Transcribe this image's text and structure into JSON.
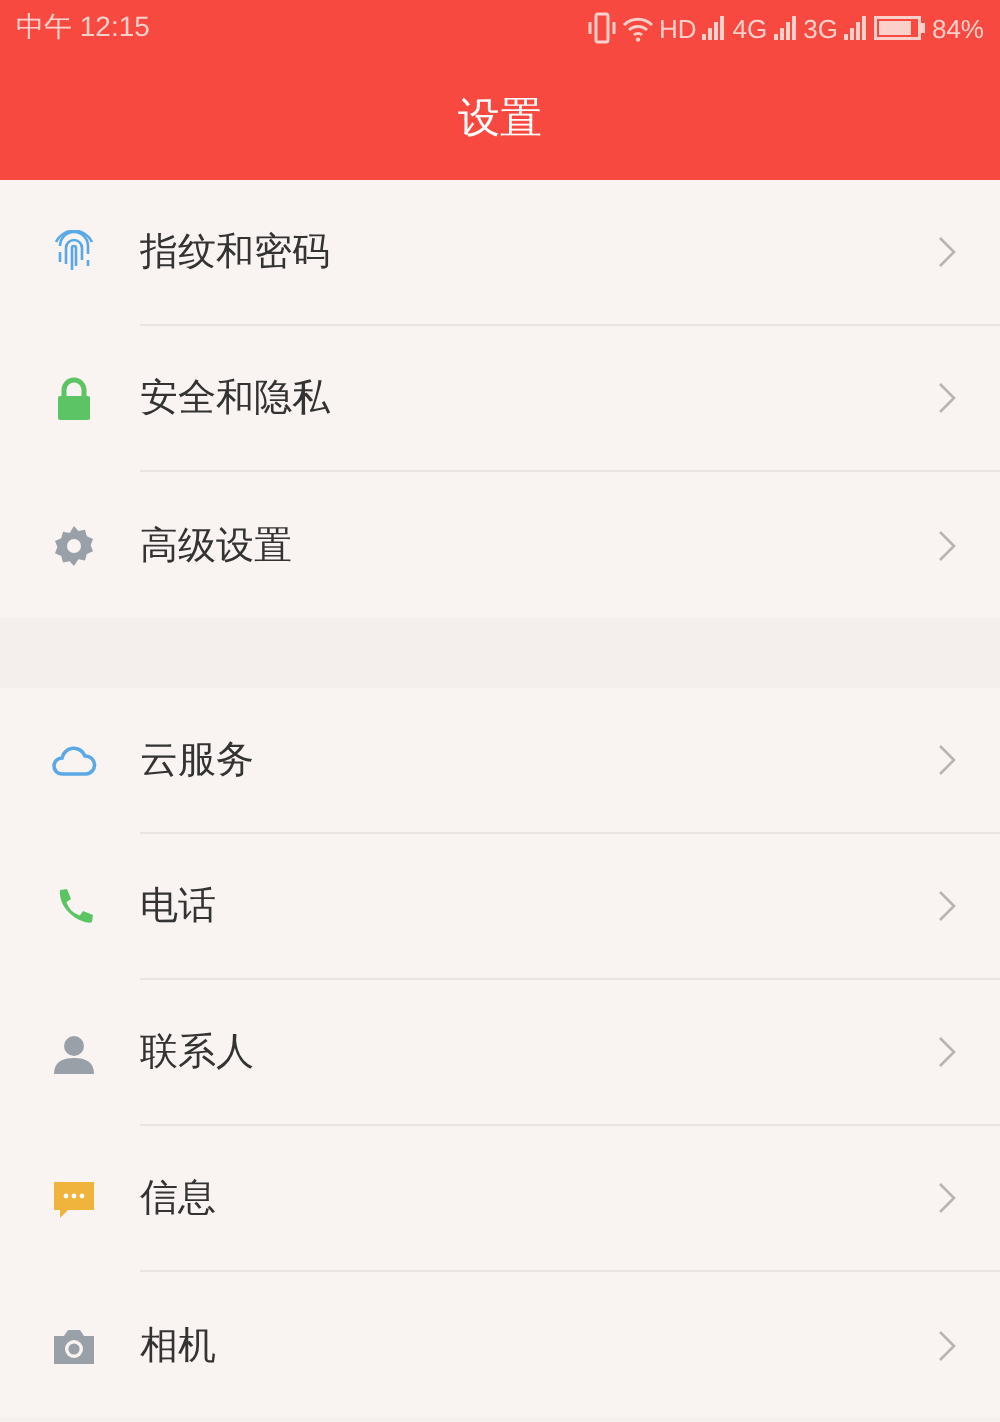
{
  "status_bar": {
    "time": "中午 12:15",
    "indicators": [
      "HD",
      "4G",
      "3G"
    ],
    "battery": "84%"
  },
  "header": {
    "title": "设置"
  },
  "groups": [
    {
      "items": [
        {
          "kind": "fingerprint",
          "label": "指纹和密码"
        },
        {
          "kind": "lock",
          "label": "安全和隐私"
        },
        {
          "kind": "gear",
          "label": "高级设置"
        }
      ]
    },
    {
      "items": [
        {
          "kind": "cloud",
          "label": "云服务"
        },
        {
          "kind": "phone",
          "label": "电话"
        },
        {
          "kind": "person",
          "label": "联系人"
        },
        {
          "kind": "message",
          "label": "信息"
        },
        {
          "kind": "camera",
          "label": "相机"
        }
      ]
    }
  ]
}
